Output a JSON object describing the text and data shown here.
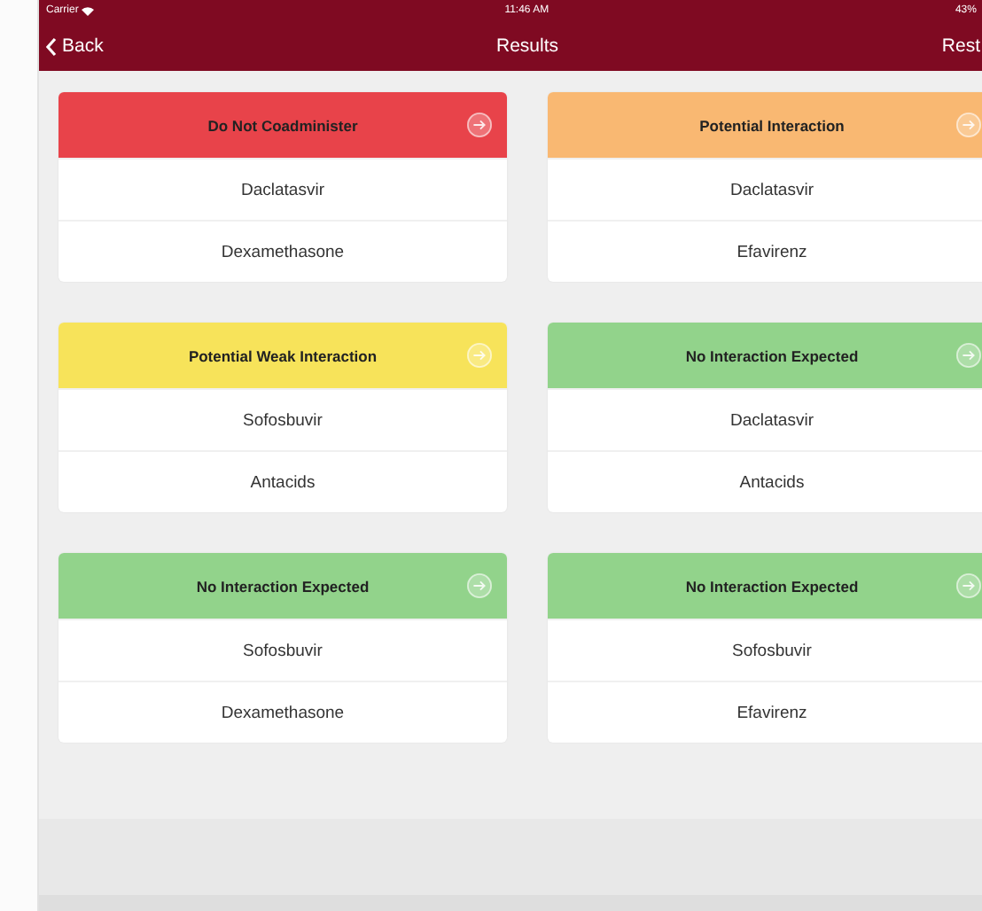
{
  "status_bar": {
    "carrier": "Carrier",
    "time": "11:46 AM",
    "battery": "43%"
  },
  "nav_bar": {
    "back": "Back",
    "title": "Results",
    "right": "Rest"
  },
  "cards": [
    {
      "title": "Do Not Coadminister",
      "color": "#e8434a",
      "drugs": [
        "Daclatasvir",
        "Dexamethasone"
      ]
    },
    {
      "title": "Potential Interaction",
      "color": "#f9b872",
      "drugs": [
        "Daclatasvir",
        "Efavirenz"
      ]
    },
    {
      "title": "Potential Weak Interaction",
      "color": "#f7e35a",
      "drugs": [
        "Sofosbuvir",
        "Antacids"
      ]
    },
    {
      "title": "No Interaction Expected",
      "color": "#92d38b",
      "drugs": [
        "Daclatasvir",
        "Antacids"
      ]
    },
    {
      "title": "No Interaction Expected",
      "color": "#92d38b",
      "drugs": [
        "Sofosbuvir",
        "Dexamethasone"
      ]
    },
    {
      "title": "No Interaction Expected",
      "color": "#92d38b",
      "drugs": [
        "Sofosbuvir",
        "Efavirenz"
      ]
    }
  ]
}
